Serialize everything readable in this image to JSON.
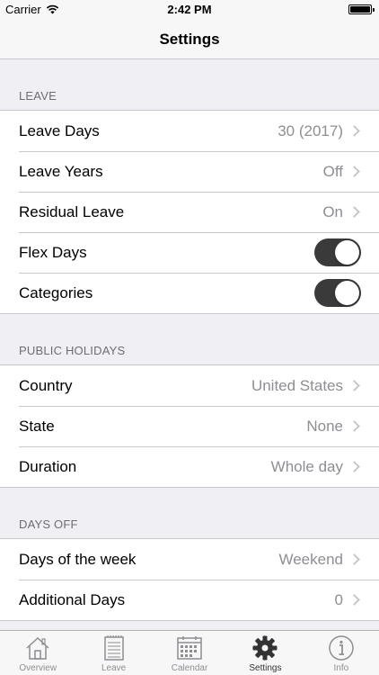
{
  "status_bar": {
    "carrier": "Carrier",
    "time": "2:42 PM"
  },
  "nav": {
    "title": "Settings"
  },
  "sections": {
    "leave": {
      "header": "LEAVE",
      "leave_days": {
        "label": "Leave Days",
        "value": "30 (2017)"
      },
      "leave_years": {
        "label": "Leave Years",
        "value": "Off"
      },
      "residual_leave": {
        "label": "Residual Leave",
        "value": "On"
      },
      "flex_days": {
        "label": "Flex Days",
        "toggle": true
      },
      "categories": {
        "label": "Categories",
        "toggle": true
      }
    },
    "public_holidays": {
      "header": "PUBLIC HOLIDAYS",
      "country": {
        "label": "Country",
        "value": "United States"
      },
      "state": {
        "label": "State",
        "value": "None"
      },
      "duration": {
        "label": "Duration",
        "value": "Whole day"
      }
    },
    "days_off": {
      "header": "DAYS OFF",
      "days_of_week": {
        "label": "Days of the week",
        "value": "Weekend"
      },
      "additional_days": {
        "label": "Additional Days",
        "value": "0"
      }
    }
  },
  "tabs": [
    {
      "label": "Overview",
      "icon": "house-icon"
    },
    {
      "label": "Leave",
      "icon": "notepad-icon"
    },
    {
      "label": "Calendar",
      "icon": "calendar-icon"
    },
    {
      "label": "Settings",
      "icon": "gear-icon",
      "active": true
    },
    {
      "label": "Info",
      "icon": "info-icon"
    }
  ],
  "colors": {
    "toggle_on": "#3a3a3a",
    "tab_active": "#333333",
    "tab_inactive": "#8e8e93"
  }
}
